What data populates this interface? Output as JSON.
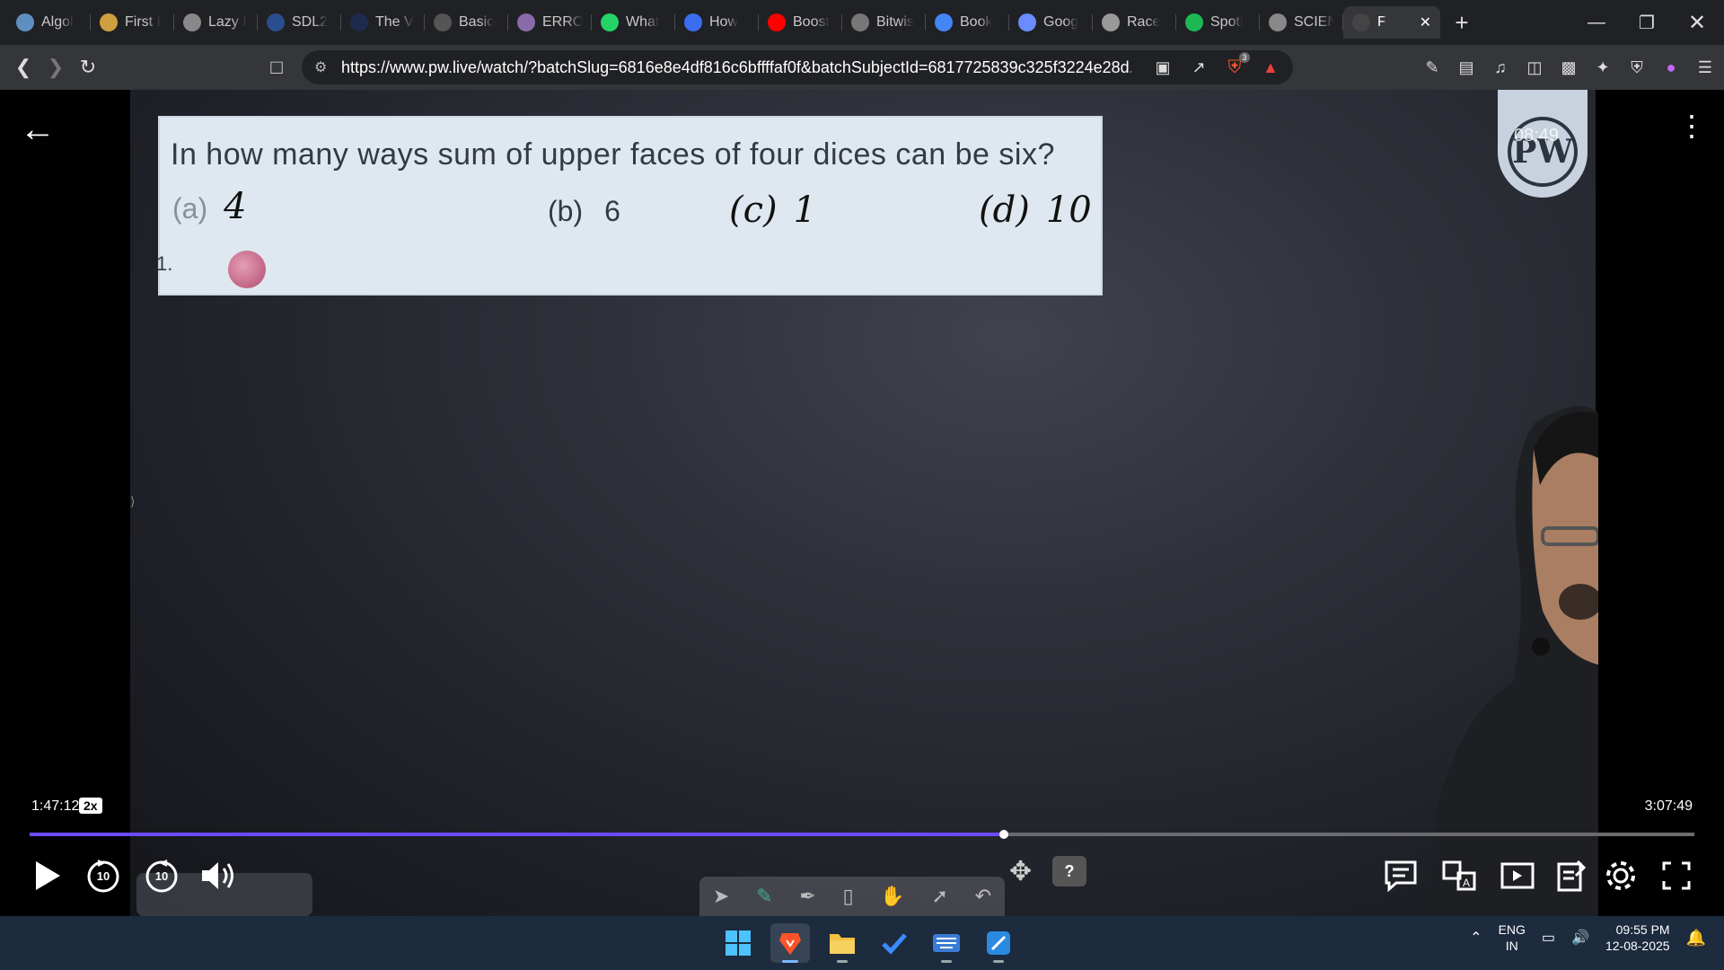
{
  "browser": {
    "tabs": [
      {
        "label": "Algol",
        "icon": "chat-icon",
        "color": "#5f8fbf"
      },
      {
        "label": "First I",
        "icon": "lightning-icon",
        "color": "#d0a040"
      },
      {
        "label": "Lazy I",
        "icon": "globe-icon",
        "color": "#888888"
      },
      {
        "label": "SDL2",
        "icon": "sdl-icon",
        "color": "#2a4d8f"
      },
      {
        "label": "The V",
        "icon": "w3-icon",
        "color": "#1e2b4f"
      },
      {
        "label": "Basic",
        "icon": "kb-icon",
        "color": "#555555"
      },
      {
        "label": "ERRO",
        "icon": "brain-icon",
        "color": "#8a6aa8"
      },
      {
        "label": "What",
        "icon": "whatsapp-icon",
        "color": "#25d366"
      },
      {
        "label": "How",
        "icon": "bookmark-icon",
        "color": "#3a6df0"
      },
      {
        "label": "Boost",
        "icon": "youtube-icon",
        "color": "#ff0000"
      },
      {
        "label": "Bitwis",
        "icon": "bitwise-icon",
        "color": "#777777"
      },
      {
        "label": "Book",
        "icon": "google-icon",
        "color": "#4285f4"
      },
      {
        "label": "Goog",
        "icon": "gemini-icon",
        "color": "#6a8cff"
      },
      {
        "label": "Race",
        "icon": "openai-icon",
        "color": "#999999"
      },
      {
        "label": "Spoti",
        "icon": "spotify-icon",
        "color": "#1db954"
      },
      {
        "label": "SCIEN",
        "icon": "globe-icon",
        "color": "#888888"
      },
      {
        "label": "F",
        "icon": "pw-icon",
        "color": "#444444",
        "active": true
      }
    ],
    "new_tab_label": "+",
    "url": "https://www.pw.live/watch/?batchSlug=6816e8e4df816c6bffffaf0f&batchSubjectId=6817725839c325f3224e28d...",
    "brave_badge": "3"
  },
  "video": {
    "question": "In how many ways sum of upper faces of four dices can be six?",
    "options": [
      {
        "label": "(a)",
        "value": "4"
      },
      {
        "label": "(b)",
        "value": "6"
      },
      {
        "label": "(c)",
        "value": "1"
      },
      {
        "label": "(d)",
        "value": "10"
      }
    ],
    "list_mark": "1.",
    "logo_text": "PW",
    "logo_stamp": "08:49",
    "time_current": "1:47:12",
    "speed": "2x",
    "time_total": "3:07:49",
    "progress": 0.585,
    "rewind_seconds": "10",
    "forward_seconds": "10",
    "accent": "#6c4bff"
  },
  "taskbar": {
    "lang_line1": "ENG",
    "lang_line2": "IN",
    "time": "09:55 PM",
    "date": "12-08-2025"
  }
}
